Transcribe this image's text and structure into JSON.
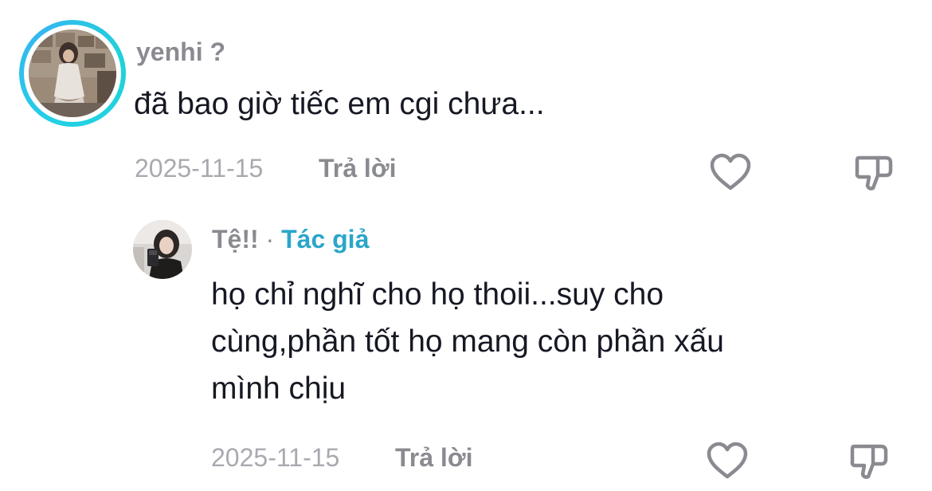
{
  "comments": [
    {
      "username": "yenhi ?",
      "text": "đã bao giờ tiếc em cgi chưa...",
      "date": "2025-11-15",
      "reply_label": "Trả lời",
      "like_icon": "heart-outline-icon",
      "dislike_icon": "thumbs-down-outline-icon",
      "avatar_ring_color": "#23d0e6"
    }
  ],
  "replies": [
    {
      "username": "Tệ!!",
      "separator": "·",
      "author_badge": "Tác giả",
      "author_badge_color": "#2ba6c9",
      "text_lines": [
        "họ chỉ nghĩ cho họ thoii...suy cho",
        "cùng,phần tốt họ mang còn phần xấu",
        "mình chịu"
      ],
      "date": "2025-11-15",
      "reply_label": "Trả lời",
      "like_icon": "heart-outline-icon",
      "dislike_icon": "thumbs-down-outline-icon"
    }
  ]
}
